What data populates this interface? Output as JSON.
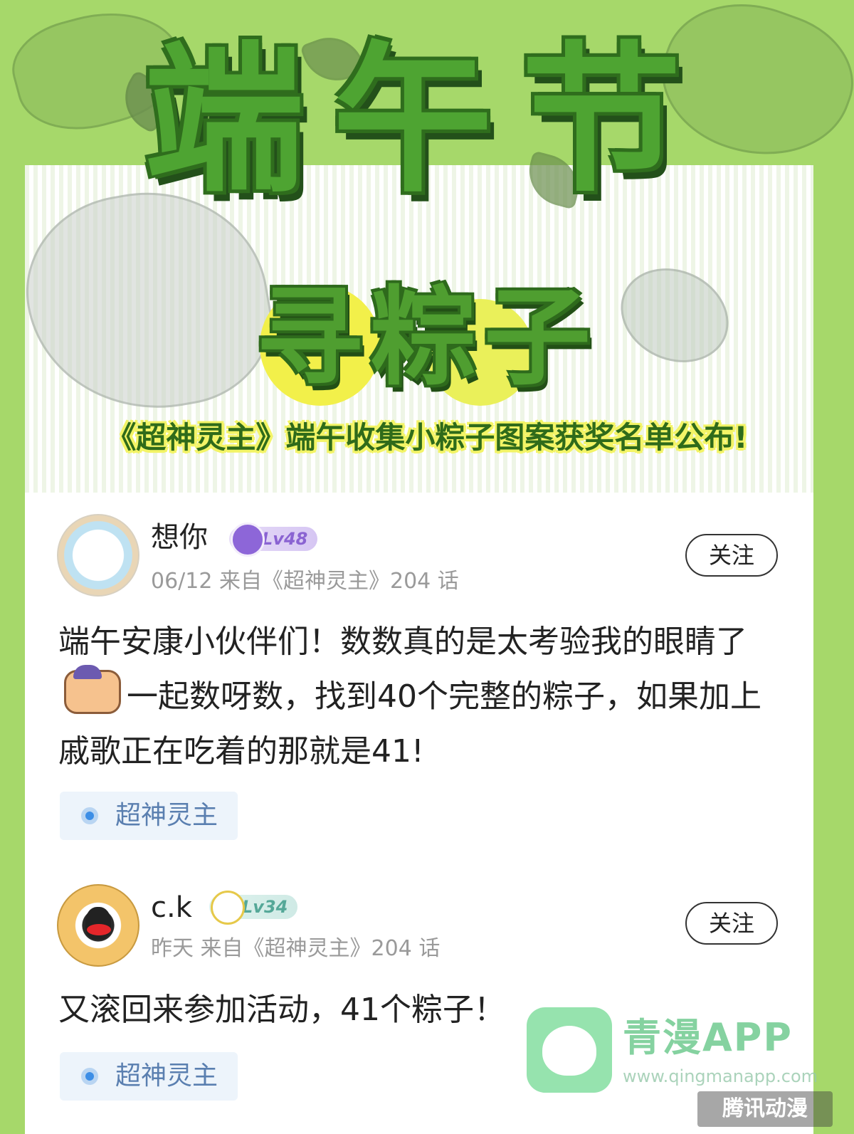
{
  "banner": {
    "title_main": "端午节",
    "title_sub": "寻粽子",
    "headline": "《超神灵主》端午收集小粽子图案获奖名单公布!"
  },
  "posts": [
    {
      "username": "想你",
      "level": "Lv48",
      "meta": "06/12 来自《超神灵主》204 话",
      "follow_label": "关注",
      "content_1": "端午安康小伙伴们！数数真的是太考验我的眼睛了",
      "content_2": "一起数呀数，找到40个完整的粽子，如果加上戚歌正在吃着的那就是41!",
      "tag": "超神灵主"
    },
    {
      "username": "c.k",
      "level": "Lv34",
      "meta": "昨天 来自《超神灵主》204 话",
      "follow_label": "关注",
      "content": "又滚回来参加活动，41个粽子！",
      "tag": "超神灵主"
    }
  ],
  "watermark": {
    "title": "青漫APP",
    "url": "www.qingmanapp.com",
    "corner": "腾讯动漫"
  },
  "colors": {
    "background": "#a6d86a",
    "title_green": "#4ea432",
    "level_purple": "#8a63d2",
    "level_teal": "#55a898",
    "tag_blue": "#3c8ee6"
  }
}
